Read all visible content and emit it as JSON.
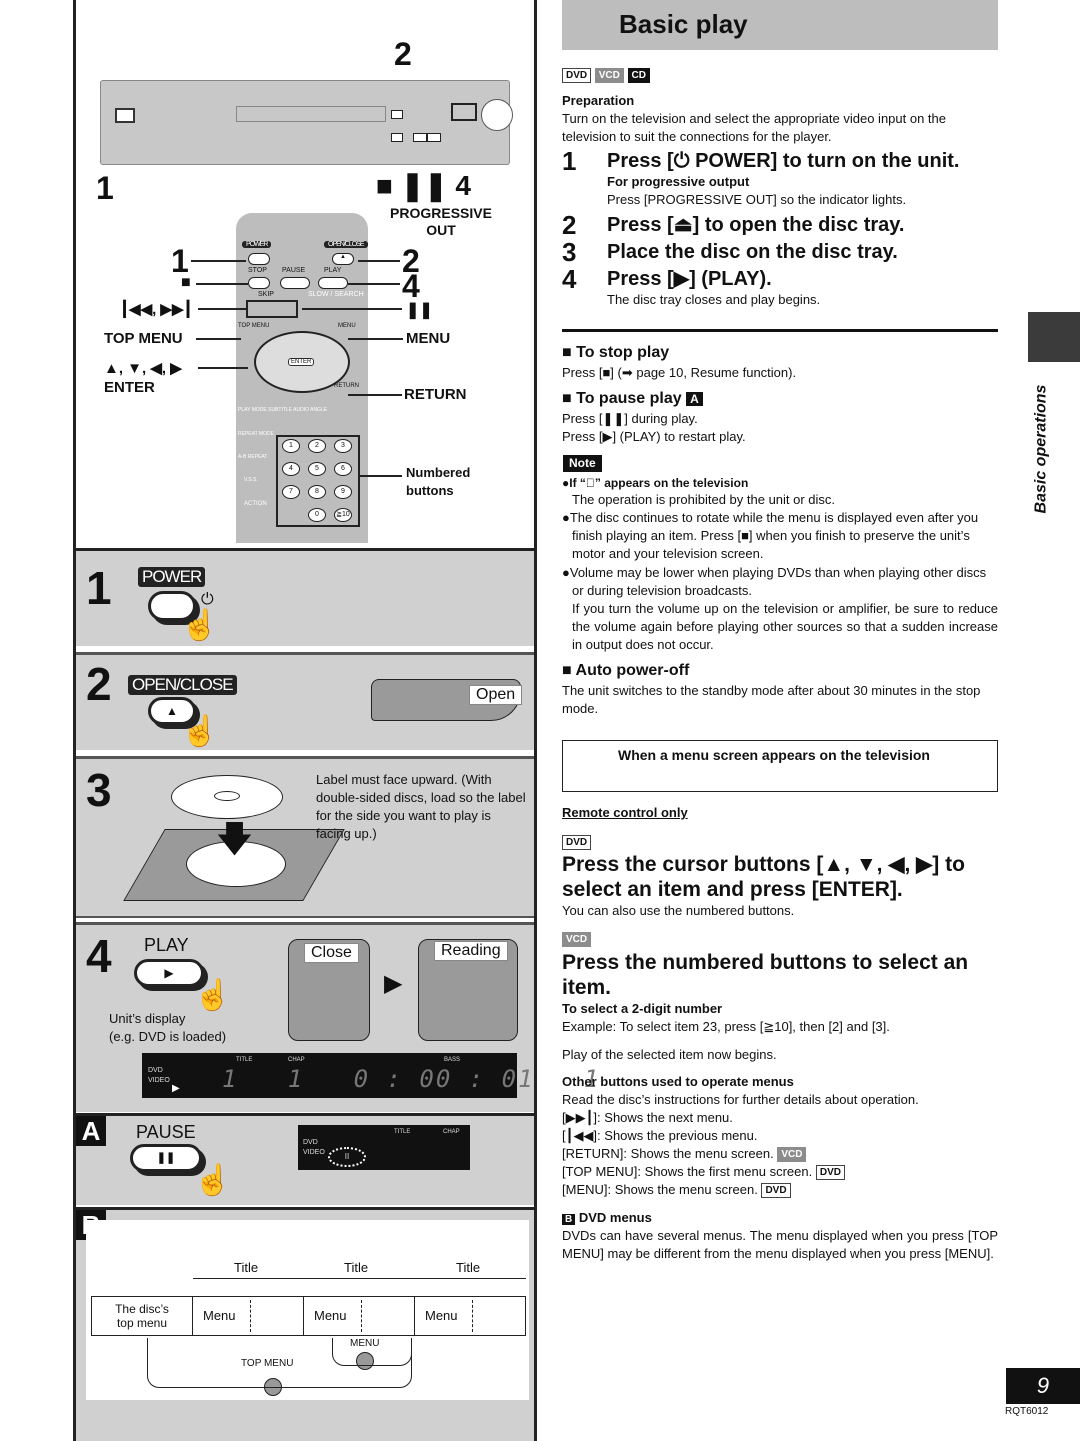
{
  "page": {
    "title": "Basic play",
    "page_number": "9",
    "doc_code": "RQT6012",
    "side_tab": "Basic operations"
  },
  "disc_tags": {
    "dvd": "DVD",
    "vcd": "VCD",
    "cd": "CD"
  },
  "preparation": {
    "heading": "Preparation",
    "text": "Turn on the television and select the appropriate video input on the television to suit the connections for the player."
  },
  "steps": [
    {
      "num": "1",
      "text": "Press [⏻ POWER] to turn on the unit.",
      "sub_heading": "For progressive output",
      "sub_text": "Press [PROGRESSIVE OUT] so the indicator lights."
    },
    {
      "num": "2",
      "text": "Press [⏏] to open the disc tray."
    },
    {
      "num": "3",
      "text": "Place the disc on the disc tray."
    },
    {
      "num": "4",
      "text": "Press [▶] (PLAY).",
      "sub_text": "The disc tray closes and play begins."
    }
  ],
  "stop_play": {
    "heading": "To stop play",
    "text": "Press [■] (➡ page 10, Resume function)."
  },
  "pause_play": {
    "heading": "To pause play",
    "badge": "A",
    "line1": "Press [❚❚] during play.",
    "line2": "Press [▶] (PLAY) to restart play."
  },
  "note": {
    "label": "Note",
    "items": [
      {
        "bold": "If “⃠” appears on the television",
        "text": "The operation is prohibited by the unit or disc."
      },
      {
        "text": "The disc continues to rotate while the menu is displayed even after you finish playing an item. Press [■] when you finish to preserve the unit’s motor and your television screen."
      },
      {
        "text": "Volume may be lower when playing DVDs than when playing other discs or during television broadcasts.",
        "text2": "If you turn the volume up on the television or amplifier, be sure to reduce the volume again before playing other sources so that a sudden increase in output does not occur."
      }
    ]
  },
  "auto_power_off": {
    "heading": "Auto power-off",
    "text": "The unit switches to the standby mode after about 30 minutes in the stop mode."
  },
  "menu_box": {
    "text": "When a menu screen appears on the television"
  },
  "remote_only": "Remote control only",
  "dvd_instruction": {
    "heading": "Press the cursor buttons [▲, ▼, ◀, ▶] to select an item and press [ENTER].",
    "text": "You can also use the numbered buttons."
  },
  "vcd_instruction": {
    "heading": "Press the numbered buttons to select an item.",
    "sub_heading": "To select a 2-digit number",
    "example": "Example:  To select item 23, press [≧10], then [2] and [3].",
    "after": "Play of the selected item now begins."
  },
  "other_buttons": {
    "heading": "Other buttons used to operate menus",
    "intro": "Read the disc’s instructions for further details about operation.",
    "items": [
      {
        "text": "[▶▶┃]:  Shows the next menu."
      },
      {
        "text": "[┃◀◀]:  Shows the previous menu."
      },
      {
        "text": "[RETURN]: Shows the menu screen.",
        "tag": "VCD"
      },
      {
        "text": "[TOP MENU]: Shows the first menu screen.",
        "tag": "DVD"
      },
      {
        "text": "[MENU]: Shows the menu screen.",
        "tag": "DVD"
      }
    ]
  },
  "dvd_menus": {
    "badge": "B",
    "heading": "DVD menus",
    "text": "DVDs can have several menus. The menu displayed when you press [TOP MENU] may be different from the menu displayed when you press [MENU]."
  },
  "illustration": {
    "unit_callouts": {
      "power": "1",
      "open": "2",
      "stop_pause_play": "■ ❚❚ 4"
    },
    "remote": {
      "labels": {
        "power": "POWER",
        "open_close": "OPEN/CLOSE",
        "stop": "STOP",
        "pause": "PAUSE",
        "play": "PLAY",
        "skip": "SKIP",
        "slow_search": "SLOW / SEARCH",
        "top_menu": "TOP MENU",
        "menu": "MENU",
        "enter": "ENTER",
        "display": "DISPLAY",
        "return": "RETURN",
        "play_mode": "PLAY MODE",
        "subtitle": "SUBTITLE",
        "audio": "AUDIO",
        "angle": "ANGLE",
        "repeat_mode": "REPEAT MODE",
        "ab_repeat": "A-B REPEAT",
        "vss": "V.S.S.",
        "action": "ACTION",
        "cancel": "CANCEL"
      },
      "numbers": [
        "1",
        "2",
        "3",
        "4",
        "5",
        "6",
        "7",
        "8",
        "9",
        "0",
        "≧10"
      ],
      "callouts": {
        "progressive_out": "PROGRESSIVE OUT",
        "c1": "1",
        "c2": "2",
        "c4": "4",
        "stop": "■",
        "pause": "❚❚",
        "skip": "┃◀◀, ▶▶┃",
        "top_menu": "TOP MENU",
        "menu": "MENU",
        "cursor": "▲, ▼, ◀, ▶",
        "enter": "ENTER",
        "return": "RETURN",
        "numbered": "Numbered buttons"
      }
    },
    "step1": {
      "num": "1",
      "key": "POWER"
    },
    "step2": {
      "num": "2",
      "key": "OPEN/CLOSE",
      "display": "Open"
    },
    "step3": {
      "num": "3",
      "caption": "Label must face upward. (With double-sided discs, load so the label for the side you want to play is facing up.)"
    },
    "step4": {
      "num": "4",
      "key": "PLAY",
      "display1": "Close",
      "display2": "Reading",
      "caption1": "Unit’s display",
      "caption2": "(e.g. DVD is loaded)"
    },
    "front_display": {
      "dvd": "DVD",
      "video": "VIDEO",
      "title": "TITLE",
      "chap": "CHAP",
      "bass": "BASS",
      "digits": "1   1   0 : 00 : 01   1"
    },
    "pause_panel": {
      "badge": "A",
      "key": "PAUSE",
      "dvd": "DVD",
      "video": "VIDEO",
      "title": "TITLE",
      "chap": "CHAP"
    },
    "menus_diagram": {
      "badge": "B",
      "titles": [
        "Title",
        "Title",
        "Title"
      ],
      "top_menu_cell": "The disc’s top menu",
      "menus": [
        "Menu",
        "Menu",
        "Menu"
      ],
      "menu_button": "MENU",
      "top_menu_button": "TOP MENU"
    }
  }
}
